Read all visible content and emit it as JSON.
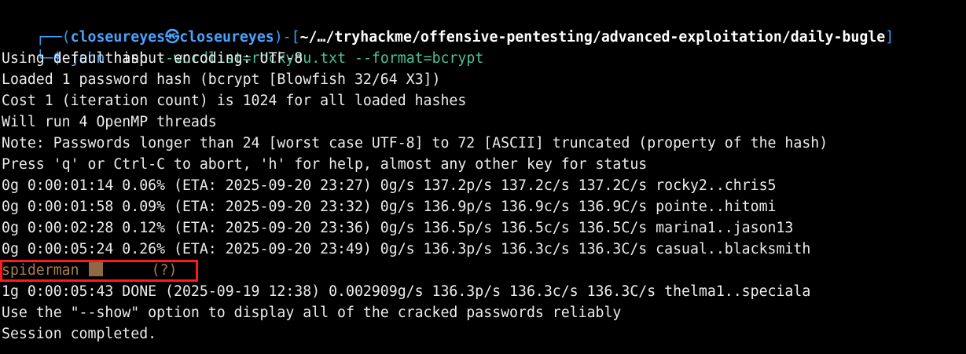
{
  "prompt": {
    "box_top": "┌──(",
    "user": "closeureyes",
    "host_icon": "kali-dragon-icon",
    "host": "closeureyes",
    "mid": ")-[",
    "path": "~/…/tryhackme/offensive-pentesting/advanced-exploitation/daily-bugle",
    "end": "]",
    "box_bottom": "└─",
    "symbol": "$",
    "command": "john",
    "arg1": "hash",
    "arg2": "--wordlist=rockyou.txt",
    "arg3": "--format=bcrypt"
  },
  "output": [
    "Using default input encoding: UTF-8",
    "Loaded 1 password hash (bcrypt [Blowfish 32/64 X3])",
    "Cost 1 (iteration count) is 1024 for all loaded hashes",
    "Will run 4 OpenMP threads",
    "Note: Passwords longer than 24 [worst case UTF-8] to 72 [ASCII] truncated (property of the hash)",
    "Press 'q' or Ctrl-C to abort, 'h' for help, almost any other key for status",
    "0g 0:00:01:14 0.06% (ETA: 2025-09-20 23:27) 0g/s 137.2p/s 137.2c/s 137.2C/s rocky2..chris5",
    "0g 0:00:01:58 0.09% (ETA: 2025-09-20 23:32) 0g/s 136.9p/s 136.9c/s 136.9C/s pointe..hitomi",
    "0g 0:00:02:28 0.12% (ETA: 2025-09-20 23:36) 0g/s 136.5p/s 136.5c/s 136.5C/s marina1..jason13",
    "0g 0:00:05:24 0.26% (ETA: 2025-09-20 23:49) 0g/s 136.3p/s 136.3c/s 136.3C/s casual..blacksmith"
  ],
  "cracked": {
    "password": "spiderman",
    "hash_label": "(?)"
  },
  "output_after": [
    "1g 0:00:05:43 DONE (2025-09-19 12:38) 0.002909g/s 136.3p/s 136.3c/s 136.3C/s thelma1..speciala",
    "Use the \"--show\" option to display all of the cracked passwords reliably",
    "Session completed."
  ],
  "colors": {
    "background": "#000000",
    "text": "#ececec",
    "prompt_green": "#35d18a",
    "prompt_blue": "#4aa3ff",
    "cracked_text": "#a77d4e",
    "highlight_border": "#ff1a1a"
  }
}
